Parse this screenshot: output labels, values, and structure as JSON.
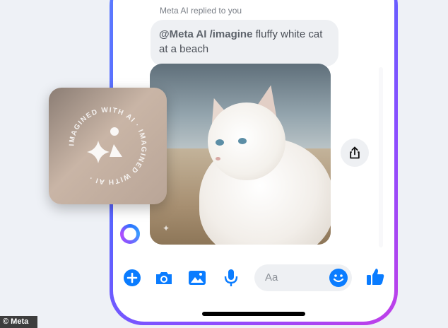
{
  "chat": {
    "reply_label": "Meta AI replied to you",
    "prompt_bold": "@Meta AI /imagine",
    "prompt_rest": " fluffy white cat at a beach"
  },
  "image": {
    "description_alt": "fluffy white cat at a beach"
  },
  "watermark_card": {
    "ring_text": "IMAGINED WITH AI · IMAGINED WITH AI ·"
  },
  "composer": {
    "placeholder": "Aa"
  },
  "icons": {
    "add": "plus-circle-icon",
    "camera": "camera-icon",
    "gallery": "image-icon",
    "mic": "microphone-icon",
    "emoji": "emoji-icon",
    "like": "thumbs-up-icon",
    "share": "share-icon"
  },
  "colors": {
    "accent": "#0a7cff",
    "frame_gradient": [
      "#5b7cff",
      "#8b4dff",
      "#c13fe8"
    ],
    "bubble_bg": "#eef0f3"
  },
  "credit": "© Meta"
}
